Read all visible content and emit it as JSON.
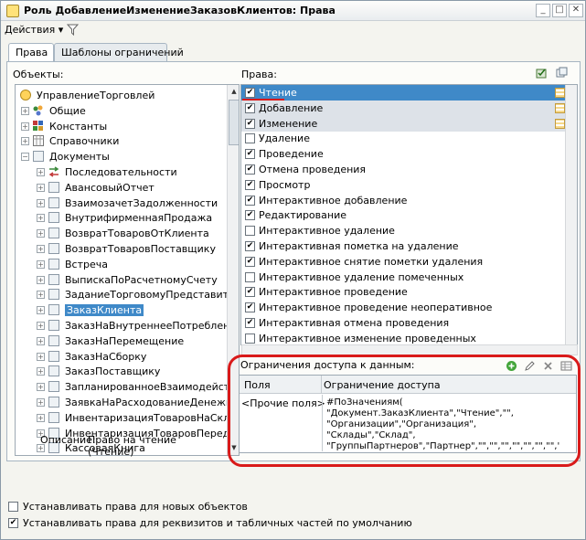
{
  "window": {
    "title": "Роль ДобавлениеИзменениеЗаказовКлиентов: Права",
    "minimize": "_",
    "maximize": "□",
    "close": "✕"
  },
  "toolbar": {
    "actions_label": "Действия",
    "actions_arrow": "▾"
  },
  "tabs": [
    "Права",
    "Шаблоны ограничений"
  ],
  "objects": {
    "label": "Объекты:",
    "items": [
      {
        "level": 0,
        "label": "УправлениеТорговлей",
        "expander": ""
      },
      {
        "level": 1,
        "label": "Общие",
        "expander": "+"
      },
      {
        "level": 1,
        "label": "Константы",
        "expander": "+"
      },
      {
        "level": 1,
        "label": "Справочники",
        "expander": "+"
      },
      {
        "level": 1,
        "label": "Документы",
        "expander": "−"
      },
      {
        "level": 2,
        "label": "Последовательности",
        "expander": "+"
      },
      {
        "level": 2,
        "label": "АвансовыйОтчет",
        "expander": "+"
      },
      {
        "level": 2,
        "label": "ВзаимозачетЗадолженности",
        "expander": "+"
      },
      {
        "level": 2,
        "label": "ВнутрифирменнаяПродажа",
        "expander": "+"
      },
      {
        "level": 2,
        "label": "ВозвратТоваровОтКлиента",
        "expander": "+"
      },
      {
        "level": 2,
        "label": "ВозвратТоваровПоставщику",
        "expander": "+"
      },
      {
        "level": 2,
        "label": "Встреча",
        "expander": "+"
      },
      {
        "level": 2,
        "label": "ВыпискаПоРасчетномуСчету",
        "expander": "+"
      },
      {
        "level": 2,
        "label": "ЗаданиеТорговомуПредставителю",
        "expander": "+"
      },
      {
        "level": 2,
        "label": "ЗаказКлиента",
        "expander": "+",
        "selected": true
      },
      {
        "level": 2,
        "label": "ЗаказНаВнутреннееПотребление",
        "expander": "+"
      },
      {
        "level": 2,
        "label": "ЗаказНаПеремещение",
        "expander": "+"
      },
      {
        "level": 2,
        "label": "ЗаказНаСборку",
        "expander": "+"
      },
      {
        "level": 2,
        "label": "ЗаказПоставщику",
        "expander": "+"
      },
      {
        "level": 2,
        "label": "ЗапланированноеВзаимодействие",
        "expander": "+"
      },
      {
        "level": 2,
        "label": "ЗаявкаНаРасходованиеДенежныхСре",
        "expander": "+"
      },
      {
        "level": 2,
        "label": "ИнвентаризацияТоваровНаСкладе",
        "expander": "+"
      },
      {
        "level": 2,
        "label": "ИнвентаризацияТоваровПереданных",
        "expander": "+"
      },
      {
        "level": 2,
        "label": "КассоваяКнига",
        "expander": "+"
      }
    ]
  },
  "rights": {
    "label": "Права:",
    "items": [
      {
        "label": "Чтение",
        "checked": true,
        "style": "selected",
        "hatched": true
      },
      {
        "label": "Добавление",
        "checked": true,
        "style": "gray",
        "hatched": true
      },
      {
        "label": "Изменение",
        "checked": true,
        "style": "gray",
        "hatched": true
      },
      {
        "label": "Удаление",
        "checked": false,
        "style": "normal"
      },
      {
        "label": "Проведение",
        "checked": true,
        "style": "normal"
      },
      {
        "label": "Отмена проведения",
        "checked": true,
        "style": "normal"
      },
      {
        "label": "Просмотр",
        "checked": true,
        "style": "normal"
      },
      {
        "label": "Интерактивное добавление",
        "checked": true,
        "style": "normal"
      },
      {
        "label": "Редактирование",
        "checked": true,
        "style": "normal"
      },
      {
        "label": "Интерактивное удаление",
        "checked": false,
        "style": "normal"
      },
      {
        "label": "Интерактивная пометка на удаление",
        "checked": true,
        "style": "normal"
      },
      {
        "label": "Интерактивное снятие пометки удаления",
        "checked": true,
        "style": "normal"
      },
      {
        "label": "Интерактивное удаление помеченных",
        "checked": false,
        "style": "normal"
      },
      {
        "label": "Интерактивное проведение",
        "checked": true,
        "style": "normal"
      },
      {
        "label": "Интерактивное проведение неоперативное",
        "checked": true,
        "style": "normal"
      },
      {
        "label": "Интерактивная отмена проведения",
        "checked": true,
        "style": "normal"
      },
      {
        "label": "Интерактивное изменение проведенных",
        "checked": false,
        "style": "normal"
      }
    ]
  },
  "constraints": {
    "label": "Ограничения доступа к данным:",
    "col_fields": "Поля",
    "col_restriction": "Ограничение доступа",
    "field": "<Прочие поля>",
    "restriction": "#ПоЗначениям( \"Документ.ЗаказКлиента\",\"Чтение\",\"\",\n\"Организации\",\"Организация\",\n\"Склады\",\"Склад\",\n\"ГруппыПартнеров\",\"Партнер\",\"\",\"\",\"\",\"\",\"\",\"\",\"\",\"\",\"\",\"\",\n\"\",\"\",\"\",\"\",\"\",\"\",\"\",\"\",\"\",\"\",\"\",\"\",\"\",\"\",\"\",\"\",\"\",\"\",\"\",\"\",\"\",\"\",\"\",\"\",\"\",\"\",\"\",\"\",\"\",\"\",\"\",\"\" )"
  },
  "description": {
    "label": "Описание:",
    "text_line1": "Право на чтение",
    "text_line2": "(Чтение)"
  },
  "bottom_options": [
    {
      "label": "Устанавливать права для новых объектов",
      "checked": false
    },
    {
      "label": "Устанавливать права для реквизитов и табличных частей по умолчанию",
      "checked": true
    }
  ],
  "colors": {
    "selection": "#3f89c8",
    "highlight_outline": "#d91a1a",
    "checkbox_hatch": "#f7d98a"
  }
}
